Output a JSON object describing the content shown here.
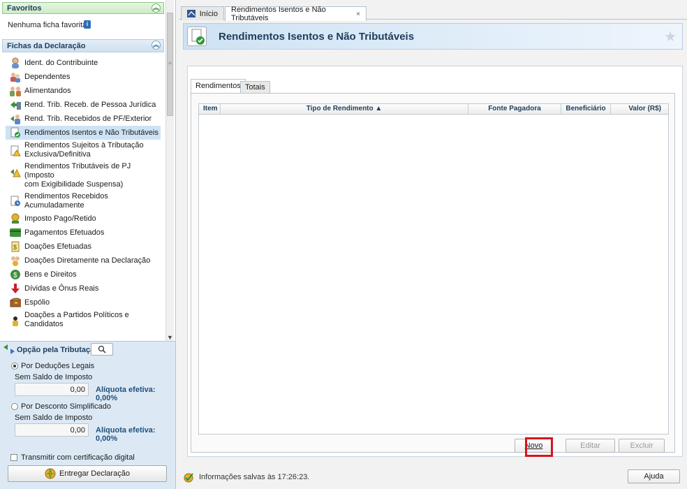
{
  "favoritos": {
    "title": "Favoritos",
    "empty_text": "Nenhuma ficha favorita"
  },
  "fichas": {
    "title": "Fichas da Declaração",
    "items": [
      {
        "label": "Ident. do Contribuinte",
        "icon": "person-icon"
      },
      {
        "label": "Dependentes",
        "icon": "dependents-icon"
      },
      {
        "label": "Alimentandos",
        "icon": "alimentandos-icon"
      },
      {
        "label": "Rend. Trib. Receb. de Pessoa Jurídica",
        "icon": "income-pj-icon"
      },
      {
        "label": "Rend. Trib. Recebidos de PF/Exterior",
        "icon": "income-pf-icon"
      },
      {
        "label": "Rendimentos Isentos e Não Tributáveis",
        "icon": "exempt-income-icon",
        "active": true
      },
      {
        "label_1": "Rendimentos Sujeitos à Tributação",
        "label_2": "Exclusiva/Definitiva",
        "icon": "warning-doc-icon"
      },
      {
        "label_1": "Rendimentos Tributáveis de PJ (Imposto",
        "label_2": "com Exigibilidade Suspensa)",
        "icon": "suspended-icon"
      },
      {
        "label": "Rendimentos Recebidos Acumuladamente",
        "icon": "accumulated-icon"
      },
      {
        "label": "Imposto Pago/Retido",
        "icon": "tax-paid-icon"
      },
      {
        "label": "Pagamentos Efetuados",
        "icon": "payment-card-icon"
      },
      {
        "label": "Doações Efetuadas",
        "icon": "donation-icon"
      },
      {
        "label": "Doações Diretamente na Declaração",
        "icon": "direct-donation-icon"
      },
      {
        "label": "Bens e Direitos",
        "icon": "assets-icon"
      },
      {
        "label": "Dívidas e Ônus Reais",
        "icon": "debt-arrow-icon"
      },
      {
        "label": "Espólio",
        "icon": "chest-icon"
      },
      {
        "label_1": "Doações a Partidos Políticos e",
        "label_2": "Candidatos",
        "icon": "party-donation-icon"
      }
    ]
  },
  "opcao": {
    "title": "Opção pela Tributação:",
    "deducoes": {
      "label": "Por Deduções Legais",
      "sub": "Sem Saldo de Imposto",
      "value": "0,00",
      "aliquota": "Alíquota efetiva: 0,00%"
    },
    "simplificado": {
      "label": "Por Desconto Simplificado",
      "sub": "Sem Saldo de Imposto",
      "value": "0,00",
      "aliquota": "Alíquota efetiva: 0,00%"
    },
    "certificado_label": "Transmitir com certificação digital",
    "entregar_label": "Entregar Declaração"
  },
  "tabs": {
    "inicio": "Início",
    "rendimentos": "Rendimentos Isentos e Não Tributáveis",
    "close": "×"
  },
  "banner": {
    "title": "Rendimentos Isentos e Não Tributáveis"
  },
  "inner_tabs": {
    "rendimentos": "Rendimentos",
    "totais": "Totais"
  },
  "grid": {
    "columns": [
      "Item",
      "Tipo de Rendimento ▲",
      "Fonte Pagadora",
      "Beneficiário",
      "Valor (R$)"
    ],
    "rows": []
  },
  "buttons": {
    "novo": "Novo",
    "editar": "Editar",
    "excluir": "Excluir",
    "ajuda": "Ajuda"
  },
  "status": {
    "text": "Informações salvas às 17:26:23."
  },
  "colors": {
    "highlight": "#d6141c",
    "active_item": "#cde3f5",
    "title": "#1d3d5a"
  }
}
